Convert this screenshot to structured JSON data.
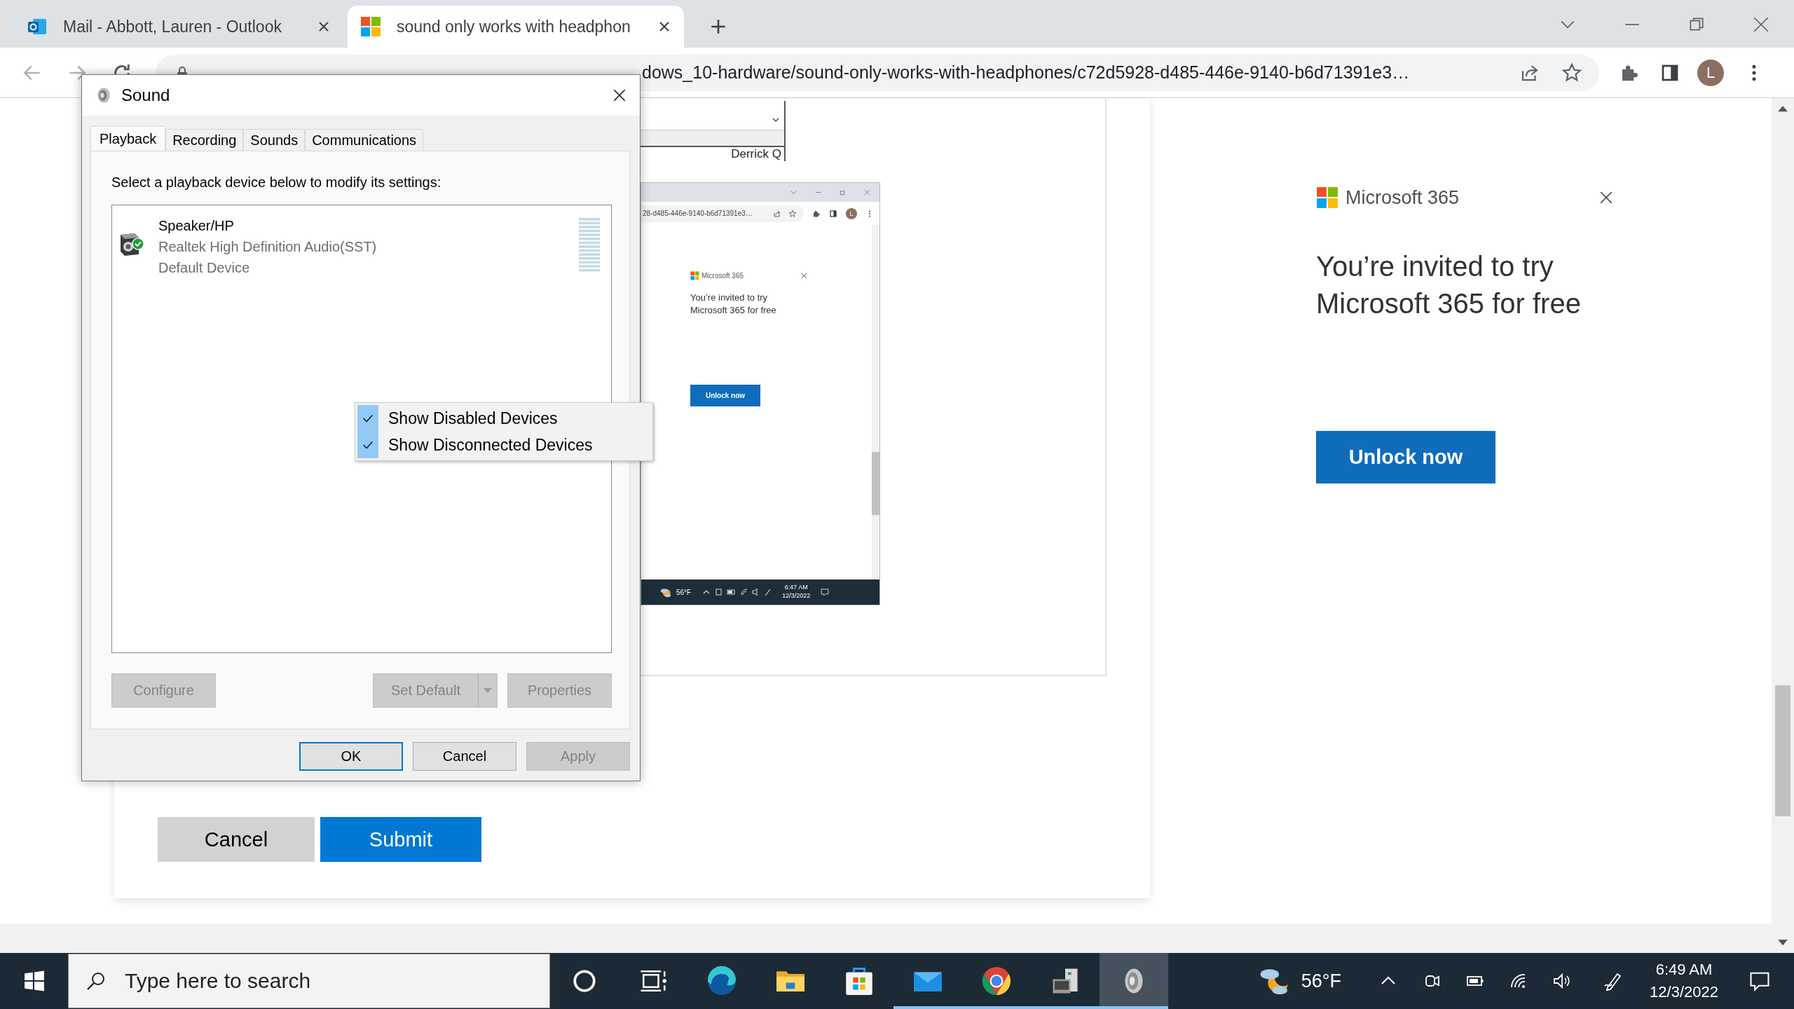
{
  "browser": {
    "tabs": [
      {
        "title": "Mail - Abbott, Lauren - Outlook",
        "kind": "mail",
        "selected": false
      },
      {
        "title": "sound only works with headphon",
        "kind": "web",
        "selected": true
      }
    ],
    "url": "dows_10-hardware/sound-only-works-with-headphones/c72d5928-d485-446e-9140-b6d71391e3…",
    "profile_initial": "L"
  },
  "post_image": {
    "cut_text": "Derrick Q",
    "url_tail": "28-d485-446e-9140-b6d71391e3…",
    "profile_initial": "L",
    "ad": {
      "brand": "Microsoft 365",
      "heading": "You’re invited to try Microsoft 365 for free",
      "button": "Unlock now"
    },
    "taskbar": {
      "temperature": "56°F",
      "time": "6:47 AM",
      "date": "12/3/2022"
    }
  },
  "form": {
    "buttons": [
      {
        "label": "Cancel",
        "kind": "secondary"
      },
      {
        "label": "Submit",
        "kind": "primary"
      }
    ]
  },
  "ad": {
    "brand": "Microsoft 365",
    "heading": "You’re invited to try Microsoft 365 for free",
    "button": "Unlock now"
  },
  "sound_dialog": {
    "title": "Sound",
    "tabs": [
      {
        "label": "Playback",
        "selected": true
      },
      {
        "label": "Recording",
        "selected": false
      },
      {
        "label": "Sounds",
        "selected": false
      },
      {
        "label": "Communications",
        "selected": false
      }
    ],
    "instruction": "Select a playback device below to modify its settings:",
    "devices": [
      {
        "name": "Speaker/HP",
        "driver": "Realtek High Definition Audio(SST)",
        "status": "Default Device",
        "default": true
      }
    ],
    "context_menu": [
      {
        "label": "Show Disabled Devices",
        "checked": true
      },
      {
        "label": "Show Disconnected Devices",
        "checked": true
      }
    ],
    "buttons": [
      {
        "label": "Configure",
        "kind": "plain",
        "disabled": true
      },
      {
        "label": "Set Default",
        "kind": "split",
        "disabled": true
      },
      {
        "label": "Properties",
        "kind": "plain",
        "disabled": true
      }
    ],
    "footer_buttons": [
      {
        "label": "OK",
        "focused": true,
        "disabled": false
      },
      {
        "label": "Cancel",
        "focused": false,
        "disabled": false
      },
      {
        "label": "Apply",
        "focused": false,
        "disabled": true
      }
    ]
  },
  "taskbar": {
    "search_placeholder": "Type here to search",
    "apps": [
      {
        "kind": "cortana",
        "running": false,
        "active": false
      },
      {
        "kind": "taskview",
        "running": false,
        "active": false
      },
      {
        "kind": "edge",
        "running": false,
        "active": false
      },
      {
        "kind": "explorer",
        "running": false,
        "active": false
      },
      {
        "kind": "store",
        "running": false,
        "active": false
      },
      {
        "kind": "mail",
        "running": true,
        "active": false
      },
      {
        "kind": "chrome",
        "running": true,
        "active": false
      },
      {
        "kind": "devices",
        "running": true,
        "active": false
      },
      {
        "kind": "sound",
        "running": true,
        "active": true
      }
    ],
    "temperature": "56°F",
    "time": "6:49 AM",
    "date": "12/3/2022"
  }
}
